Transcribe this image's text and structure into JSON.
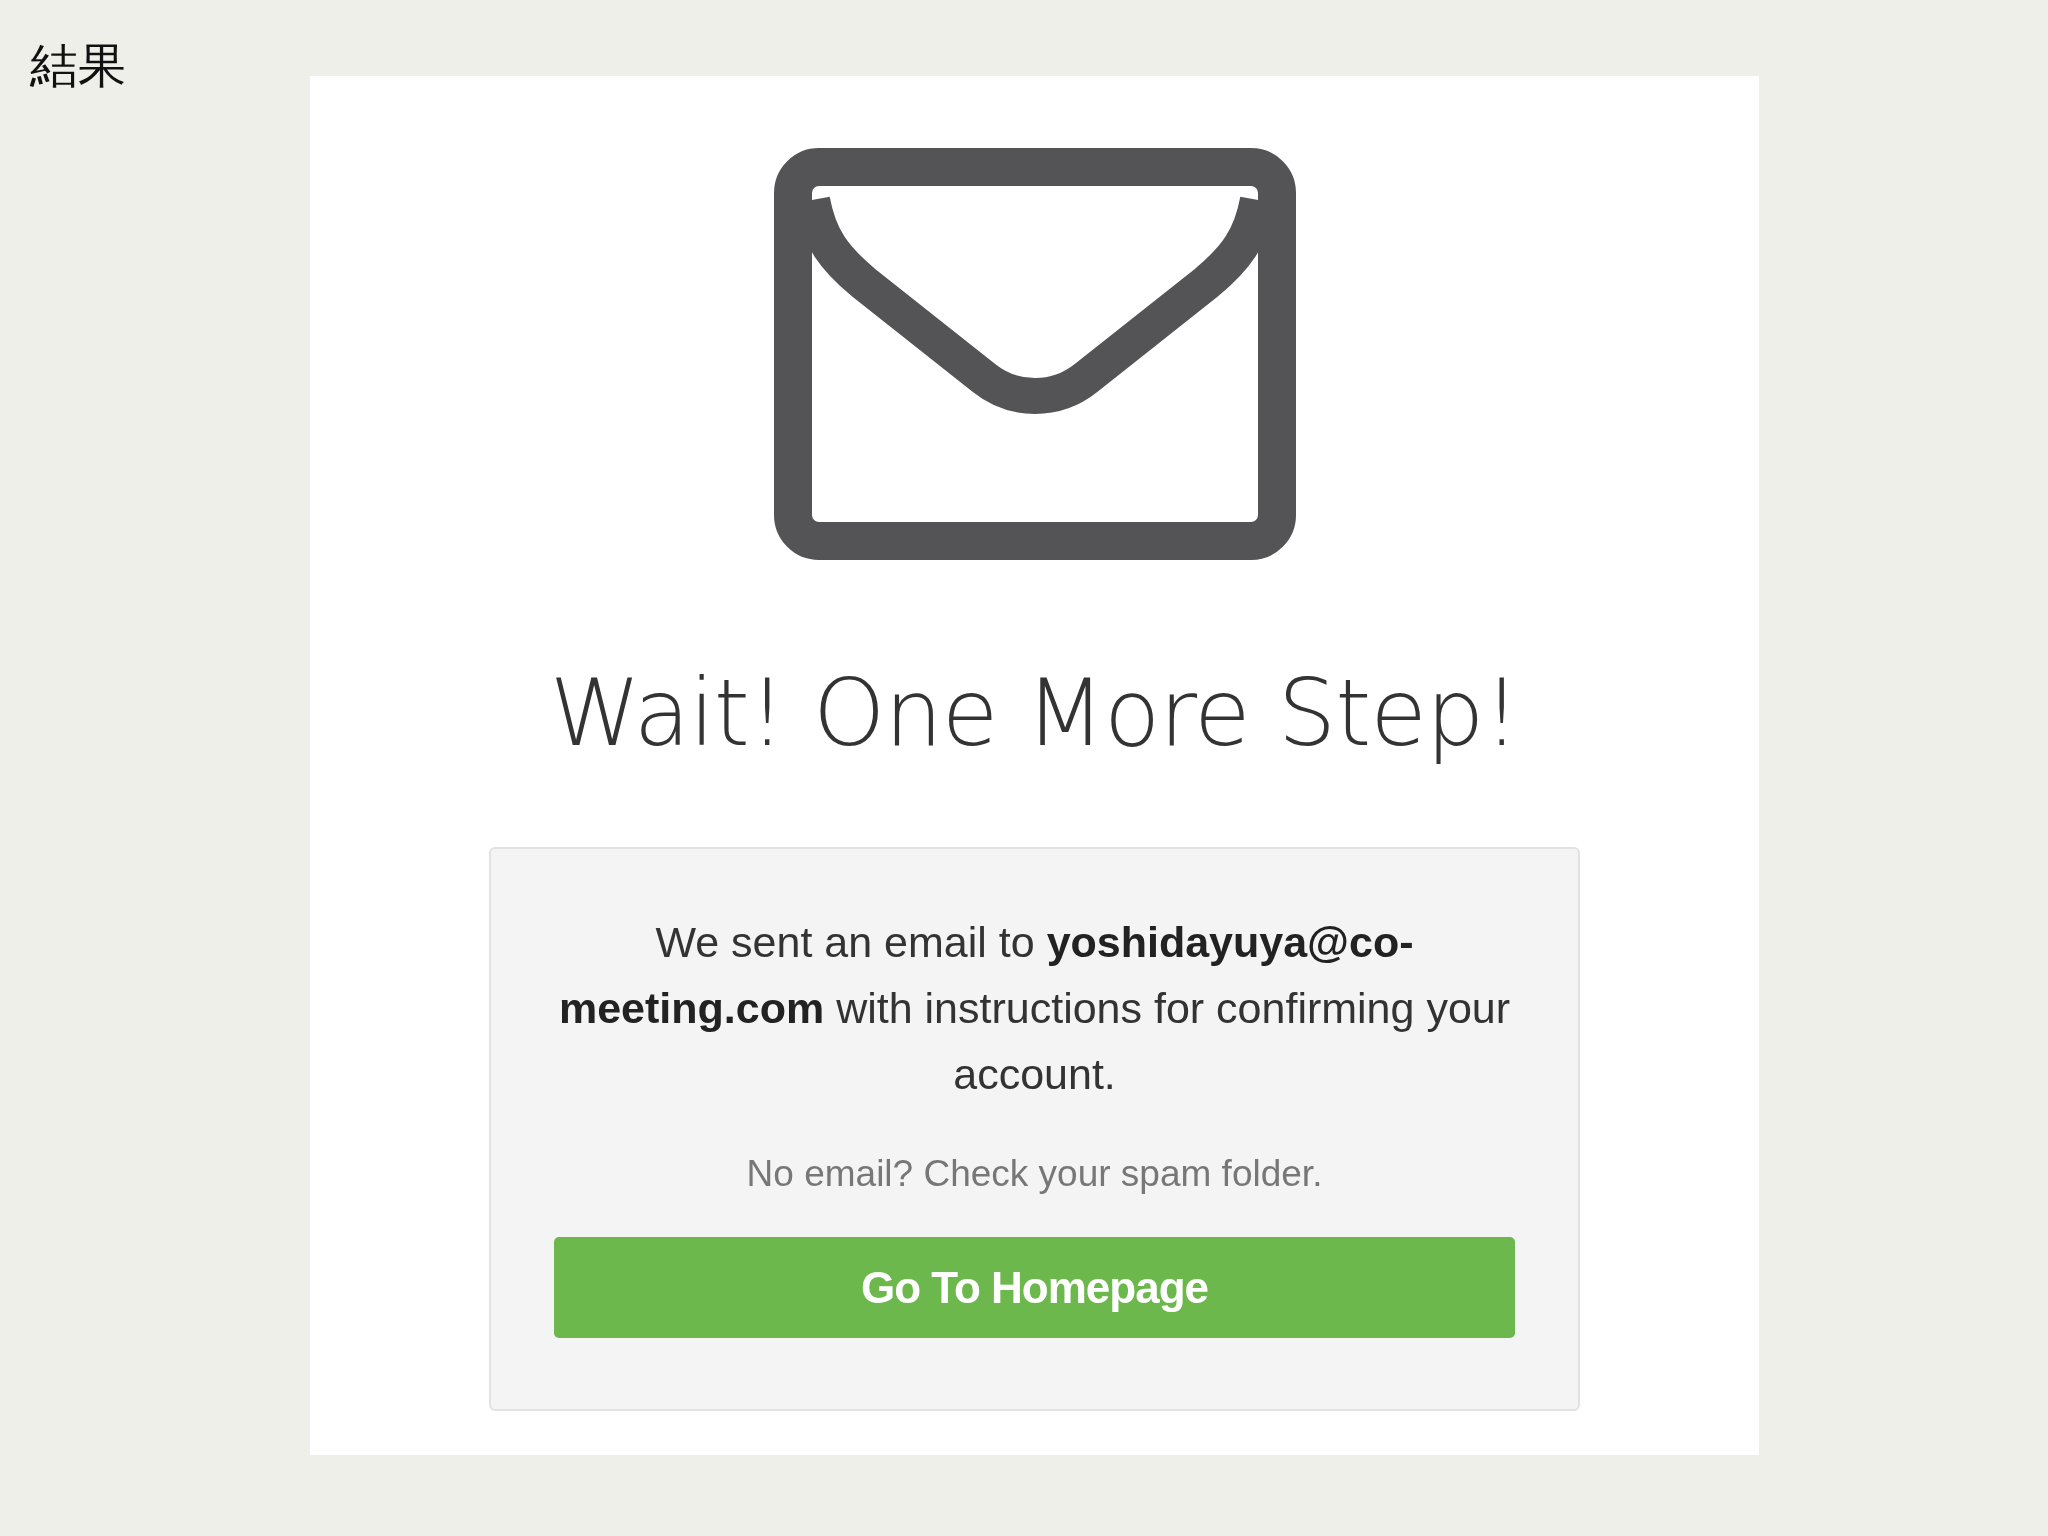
{
  "page_label": "結果",
  "card": {
    "title": "Wait! One More Step!",
    "message": "We sent an email to **yoshidayuya@co-meeting.com** with instructions for confirming your account.",
    "hint": "No email? Check your spam folder.",
    "button": "Go To Homepage"
  }
}
